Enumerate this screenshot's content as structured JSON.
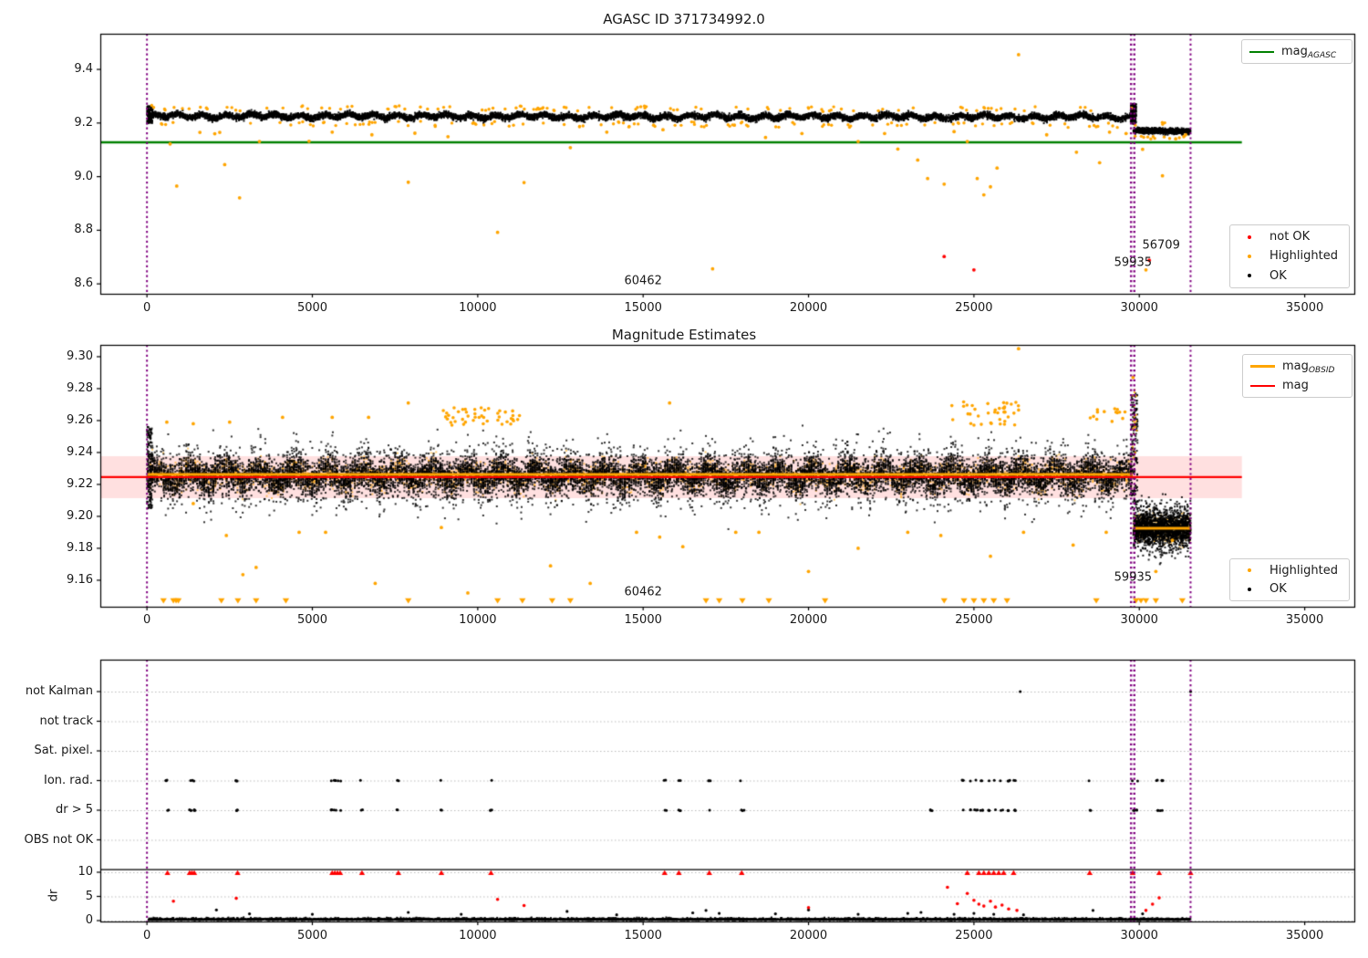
{
  "colors": {
    "ok": "#000000",
    "highlighted": "#ffa500",
    "not_ok": "#ff0000",
    "green_line": "#008000",
    "red_line": "#ff0000",
    "orange_line": "#ffa500",
    "purple_vline": "#800080",
    "pink_band": "rgba(255,0,0,0.12)",
    "grid": "#bdbdbd",
    "spine": "#000000"
  },
  "chart_data": [
    {
      "type": "scatter",
      "title": "AGASC ID 371734992.0",
      "xlabel": "",
      "ylabel": "",
      "xlim": [
        -1410,
        36500
      ],
      "ylim": [
        8.563,
        9.533
      ],
      "xticks": [
        "0",
        "5000",
        "10000",
        "15000",
        "20000",
        "25000",
        "30000",
        "35000"
      ],
      "xtick_values": [
        0,
        5000,
        10000,
        15000,
        20000,
        25000,
        30000,
        35000
      ],
      "yticks": [
        "9.4",
        "9.2",
        "9.0",
        "8.8",
        "8.6"
      ],
      "ytick_values": [
        9.4,
        9.2,
        9.0,
        8.8,
        8.6
      ],
      "legend_line": {
        "text": "mag",
        "sub": "AGASC",
        "color": "#008000"
      },
      "legend_markers": [
        {
          "label": "not OK",
          "color": "#ff0000"
        },
        {
          "label": "Highlighted",
          "color": "#ffa500"
        },
        {
          "label": "OK",
          "color": "#000000"
        }
      ],
      "hline": {
        "y": 9.128,
        "x0": -1410,
        "x1": 33100,
        "color": "#008000"
      },
      "vlines": [
        {
          "x": 0,
          "thick": false
        },
        {
          "x": 29800,
          "thick": true
        },
        {
          "x": 31550,
          "thick": false
        }
      ],
      "band_main": {
        "x0": 40,
        "x1": 29800,
        "center": 9.2265,
        "sigma": 0.0095,
        "n": 9000
      },
      "band_tail": {
        "x0": 29820,
        "x1": 31550,
        "center": 9.1715,
        "sigma": 0.0085,
        "n": 900
      },
      "edge_highlight_n": 220,
      "highlighted_points": [
        [
          700,
          9.122
        ],
        [
          900,
          8.965
        ],
        [
          1600,
          9.165
        ],
        [
          2050,
          9.16
        ],
        [
          2200,
          9.165
        ],
        [
          2350,
          9.045
        ],
        [
          2800,
          8.921
        ],
        [
          3400,
          9.131
        ],
        [
          4900,
          9.132
        ],
        [
          5600,
          9.166
        ],
        [
          6800,
          9.156
        ],
        [
          7900,
          8.979
        ],
        [
          8100,
          9.162
        ],
        [
          9100,
          9.149
        ],
        [
          10600,
          8.792
        ],
        [
          11400,
          8.978
        ],
        [
          12800,
          9.108
        ],
        [
          13900,
          9.166
        ],
        [
          15600,
          9.175
        ],
        [
          17100,
          8.656
        ],
        [
          18700,
          9.146
        ],
        [
          19800,
          9.161
        ],
        [
          21500,
          9.131
        ],
        [
          22300,
          9.161
        ],
        [
          22700,
          9.103
        ],
        [
          23300,
          9.062
        ],
        [
          23600,
          8.993
        ],
        [
          24100,
          8.972
        ],
        [
          24400,
          9.168
        ],
        [
          24800,
          9.131
        ],
        [
          25100,
          8.993
        ],
        [
          25300,
          8.932
        ],
        [
          25500,
          8.962
        ],
        [
          25700,
          9.032
        ],
        [
          26350,
          9.455
        ],
        [
          27200,
          9.156
        ],
        [
          28100,
          9.091
        ],
        [
          28800,
          9.052
        ],
        [
          29100,
          9.166
        ],
        [
          29600,
          9.161
        ],
        [
          30100,
          9.102
        ],
        [
          30200,
          8.652
        ],
        [
          30700,
          9.003
        ],
        [
          31100,
          9.141
        ],
        [
          31400,
          9.156
        ]
      ],
      "not_ok_points": [
        [
          24100,
          8.702
        ],
        [
          25000,
          8.652
        ],
        [
          30300,
          8.688
        ]
      ],
      "annotations": [
        {
          "text": "60462",
          "x": 15000,
          "y": 8.61
        },
        {
          "text": "59935",
          "x": 29810,
          "y": 8.678
        },
        {
          "text": "56709",
          "x": 30660,
          "y": 8.745
        }
      ]
    },
    {
      "type": "scatter",
      "title": "Magnitude Estimates",
      "xlabel": "",
      "ylabel": "",
      "xlim": [
        -1410,
        36500
      ],
      "ylim": [
        9.1434,
        9.3074
      ],
      "xticks": [
        "0",
        "5000",
        "10000",
        "15000",
        "20000",
        "25000",
        "30000",
        "35000"
      ],
      "xtick_values": [
        0,
        5000,
        10000,
        15000,
        20000,
        25000,
        30000,
        35000
      ],
      "yticks": [
        "9.30",
        "9.28",
        "9.26",
        "9.24",
        "9.22",
        "9.20",
        "9.18",
        "9.16"
      ],
      "ytick_values": [
        9.3,
        9.28,
        9.26,
        9.24,
        9.22,
        9.2,
        9.18,
        9.16
      ],
      "legend_lines": [
        {
          "text": "mag",
          "sub": "OBSID",
          "color": "#ffa500"
        },
        {
          "text": "mag",
          "sub": "",
          "color": "#ff0000"
        }
      ],
      "legend_markers": [
        {
          "label": "Highlighted",
          "color": "#ffa500"
        },
        {
          "label": "OK",
          "color": "#000000"
        }
      ],
      "mag_line": {
        "y": 9.2246,
        "x0": -1410,
        "x1": 33100,
        "band_lo": 9.2114,
        "band_hi": 9.2377
      },
      "obsid_segments": [
        {
          "x0": 0,
          "x1": 29800,
          "y": 9.2262
        },
        {
          "x0": 29820,
          "x1": 31550,
          "y": 9.1925
        }
      ],
      "vlines": [
        {
          "x": 0,
          "thick": false
        },
        {
          "x": 29800,
          "thick": true
        },
        {
          "x": 31550,
          "thick": false
        }
      ],
      "band_main": {
        "x0": 30,
        "x1": 29800,
        "center": 9.2255,
        "sigma_core": 0.008,
        "sigma_mid": 0.0145,
        "sigma_out": 0.019,
        "n_black": 14000,
        "n_orange": 3500
      },
      "band_tail": {
        "x0": 29820,
        "x1": 31550,
        "center": 9.1925,
        "sigma_core": 0.008,
        "sigma_mid": 0.014,
        "n_black": 1900,
        "n_orange": 400
      },
      "top_clusters": [
        {
          "x0": 8800,
          "x1": 11300,
          "y0": 9.257,
          "y1": 9.268,
          "n": 45
        },
        {
          "x0": 24300,
          "x1": 26600,
          "y0": 9.257,
          "y1": 9.272,
          "n": 40
        },
        {
          "x0": 28400,
          "x1": 29800,
          "y0": 9.259,
          "y1": 9.268,
          "n": 14
        }
      ],
      "highlighted_points": [
        [
          600,
          9.259
        ],
        [
          1400,
          9.258
        ],
        [
          2500,
          9.259
        ],
        [
          4100,
          9.262
        ],
        [
          5600,
          9.262
        ],
        [
          6700,
          9.262
        ],
        [
          7900,
          9.271
        ],
        [
          15800,
          9.271
        ],
        [
          26350,
          9.305
        ],
        [
          29810,
          9.287
        ],
        [
          1400,
          9.208
        ],
        [
          2400,
          9.188
        ],
        [
          2900,
          9.1635
        ],
        [
          3300,
          9.168
        ],
        [
          4600,
          9.19
        ],
        [
          5400,
          9.19
        ],
        [
          6900,
          9.158
        ],
        [
          8900,
          9.193
        ],
        [
          9700,
          9.152
        ],
        [
          12200,
          9.169
        ],
        [
          13400,
          9.158
        ],
        [
          14800,
          9.19
        ],
        [
          15500,
          9.187
        ],
        [
          16200,
          9.181
        ],
        [
          17800,
          9.19
        ],
        [
          18500,
          9.19
        ],
        [
          20000,
          9.1655
        ],
        [
          21500,
          9.18
        ],
        [
          23000,
          9.19
        ],
        [
          24000,
          9.188
        ],
        [
          25500,
          9.175
        ],
        [
          26500,
          9.19
        ],
        [
          28000,
          9.182
        ],
        [
          29000,
          9.19
        ],
        [
          30500,
          9.1655
        ],
        [
          31000,
          9.185
        ]
      ],
      "clip_triangles_x": [
        500,
        800,
        880,
        950,
        2250,
        2750,
        3300,
        4200,
        7900,
        10600,
        11350,
        12250,
        12800,
        16900,
        17300,
        18000,
        18800,
        20500,
        24100,
        24700,
        25000,
        25300,
        25600,
        26000,
        28700,
        29900,
        30050,
        30200,
        30500,
        31300
      ],
      "annotations": [
        {
          "text": "60462",
          "x": 15000,
          "y": 9.1526
        },
        {
          "text": "59935",
          "x": 29810,
          "y": 9.1617
        }
      ]
    },
    {
      "type": "scatter",
      "title": "",
      "xlabel": "",
      "ylabel": "dr",
      "xlim": [
        -1410,
        36500
      ],
      "xticks": [
        "0",
        "5000",
        "10000",
        "15000",
        "20000",
        "25000",
        "30000",
        "35000"
      ],
      "xtick_values": [
        0,
        5000,
        10000,
        15000,
        20000,
        25000,
        30000,
        35000
      ],
      "categories": [
        "not Kalman",
        "not track",
        "Sat. pixel.",
        "Ion. rad.",
        "dr > 5",
        "OBS not OK"
      ],
      "dr_ticks": [
        "10",
        "5",
        "0"
      ],
      "dr_tick_values": [
        10,
        5,
        0
      ],
      "vlines": [
        {
          "x": 0,
          "thick": false
        },
        {
          "x": 29800,
          "thick": true
        },
        {
          "x": 31550,
          "thick": false
        }
      ],
      "clip_line_dr": 10.55,
      "flags_x": {
        "not_kalman": [
          26400,
          31550
        ],
        "not_track": [],
        "sat_pixel": [],
        "ion_rad": [
          620,
          1280,
          1350,
          1420,
          2720,
          5580,
          5660,
          5740,
          5820,
          6500,
          7600,
          8900,
          10400,
          15650,
          16100,
          17000,
          18000,
          24650,
          24850,
          25050,
          25250,
          25450,
          25650,
          25850,
          26050,
          26250,
          28500,
          29850,
          29950,
          30550,
          30700
        ],
        "dr_gt5": [
          620,
          1280,
          1350,
          1420,
          2720,
          5580,
          5660,
          5740,
          5820,
          6500,
          7600,
          8900,
          10400,
          15650,
          16100,
          17000,
          18000,
          23700,
          24650,
          24850,
          25050,
          25250,
          25450,
          25650,
          25850,
          26050,
          26250,
          28500,
          29850,
          29950,
          30550,
          30700
        ],
        "obs_not_ok": []
      },
      "red_clip_x": [
        620,
        1290,
        1360,
        1430,
        2740,
        5600,
        5680,
        5760,
        5840,
        6500,
        7600,
        8900,
        10400,
        15650,
        16080,
        17000,
        17980,
        24800,
        25150,
        25300,
        25450,
        25600,
        25750,
        25900,
        26200,
        28500,
        29800,
        30600,
        31550
      ],
      "red_dr_points": [
        [
          800,
          4.0
        ],
        [
          2700,
          4.6
        ],
        [
          10600,
          4.4
        ],
        [
          11400,
          3.1
        ],
        [
          20000,
          2.7
        ],
        [
          24200,
          6.9
        ],
        [
          24500,
          3.5
        ],
        [
          24800,
          5.6
        ],
        [
          25000,
          4.2
        ],
        [
          25150,
          3.4
        ],
        [
          25300,
          3.0
        ],
        [
          25500,
          4.0
        ],
        [
          25650,
          2.8
        ],
        [
          25850,
          3.2
        ],
        [
          26050,
          2.4
        ],
        [
          26300,
          2.1
        ],
        [
          30200,
          2.1
        ],
        [
          30400,
          3.4
        ],
        [
          30600,
          4.7
        ]
      ],
      "black_dr_outliers": [
        [
          2100,
          2.2
        ],
        [
          3100,
          1.4
        ],
        [
          5000,
          1.3
        ],
        [
          7900,
          1.7
        ],
        [
          9500,
          1.3
        ],
        [
          12700,
          1.9
        ],
        [
          14200,
          1.2
        ],
        [
          16500,
          1.6
        ],
        [
          16900,
          2.1
        ],
        [
          17300,
          1.5
        ],
        [
          19000,
          1.4
        ],
        [
          20000,
          2.2
        ],
        [
          21500,
          1.3
        ],
        [
          23000,
          1.5
        ],
        [
          23400,
          1.7
        ],
        [
          24400,
          1.3
        ],
        [
          25000,
          1.5
        ],
        [
          25600,
          1.3
        ],
        [
          26500,
          1.2
        ],
        [
          28600,
          2.1
        ],
        [
          30100,
          1.4
        ]
      ],
      "dense_band": {
        "x0": 40,
        "x1": 31550,
        "n": 5200
      }
    }
  ]
}
